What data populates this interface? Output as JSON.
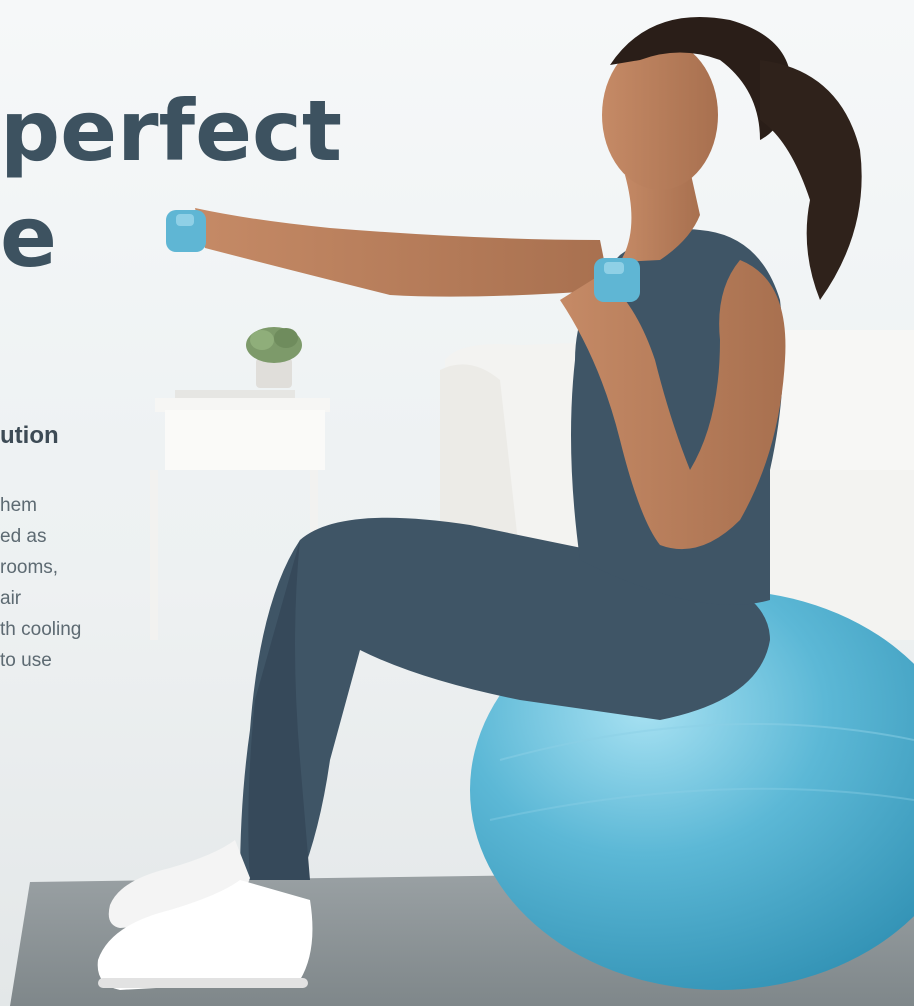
{
  "hero": {
    "headline_line1": "perfect",
    "headline_line2": "e",
    "subheading": "ution",
    "body_lines": [
      "hem",
      "ed as",
      " rooms,",
      " air",
      "th cooling",
      " to use"
    ]
  },
  "colors": {
    "headline": "#3d5260",
    "body": "#5d6a72",
    "exercise_ball": "#5cb8d6",
    "dumbbell": "#5fb6d4",
    "outfit": "#3f5566",
    "mat": "#8c9396"
  },
  "image": {
    "scene": "woman exercising on blue ball with dumbbells"
  }
}
